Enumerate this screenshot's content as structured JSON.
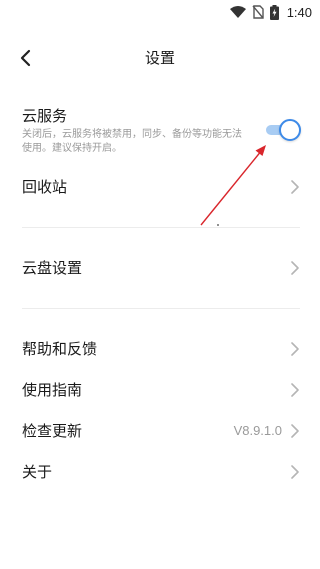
{
  "status_bar": {
    "time": "1:40",
    "icons": [
      "wifi-icon",
      "no-sim-icon",
      "battery-charging-icon"
    ]
  },
  "header": {
    "title": "设置",
    "back_icon": "chevron-left-icon"
  },
  "cloud_service": {
    "title": "云服务",
    "description": "关闭后，云服务将被禁用，同步、备份等功能无法使用。建议保持开启。",
    "enabled": true
  },
  "menu": {
    "recycle_bin": {
      "label": "回收站"
    },
    "cloud_disk_settings": {
      "label": "云盘设置"
    },
    "help_feedback": {
      "label": "帮助和反馈"
    },
    "user_guide": {
      "label": "使用指南"
    },
    "check_update": {
      "label": "检查更新",
      "value": "V8.9.1.0"
    },
    "about": {
      "label": "关于"
    }
  },
  "colors": {
    "accent": "#3d8ae8",
    "toggle_track": "#a8ccf3",
    "annotation_arrow": "#d9262c",
    "secondary_text": "#9a9a9a",
    "divider": "#ececec"
  }
}
